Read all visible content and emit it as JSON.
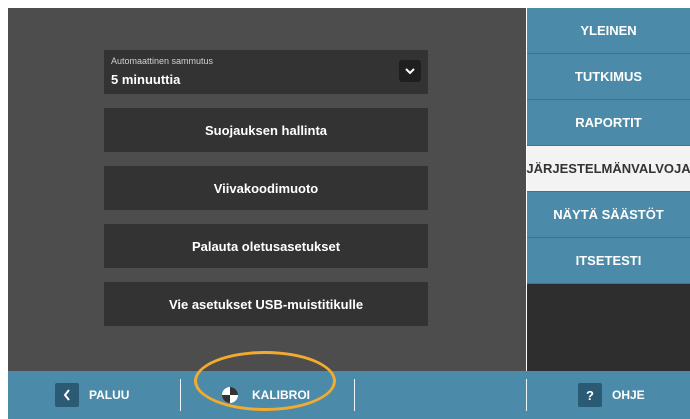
{
  "settings": {
    "auto_shutdown": {
      "label": "Automaattinen sammutus",
      "value": "5 minuuttia",
      "toggle_icon": "chevron-down-icon"
    },
    "buttons": [
      "Suojauksen hallinta",
      "Viivakoodimuoto",
      "Palauta oletusasetukset",
      "Vie asetukset USB-muistitikulle"
    ]
  },
  "sidebar": {
    "items": [
      {
        "label": "YLEINEN",
        "active": false
      },
      {
        "label": "TUTKIMUS",
        "active": false
      },
      {
        "label": "RAPORTIT",
        "active": false
      },
      {
        "label": "JÄRJESTELMÄNVALVOJA",
        "active": true
      },
      {
        "label": "NÄYTÄ SÄÄSTÖT",
        "active": false
      },
      {
        "label": "ITSETESTI",
        "active": false
      }
    ]
  },
  "bottom_bar": {
    "back": {
      "label": "PALUU",
      "icon": "chevron-left-icon"
    },
    "calibrate": {
      "label": "KALIBROI",
      "icon": "calibration-target-icon"
    },
    "help": {
      "label": "OHJE",
      "icon": "question-icon",
      "icon_glyph": "?"
    }
  },
  "colors": {
    "accent": "#4b8aa8",
    "highlight": "#f2ab2f",
    "panel": "#4d4d4d",
    "button": "#333333"
  }
}
